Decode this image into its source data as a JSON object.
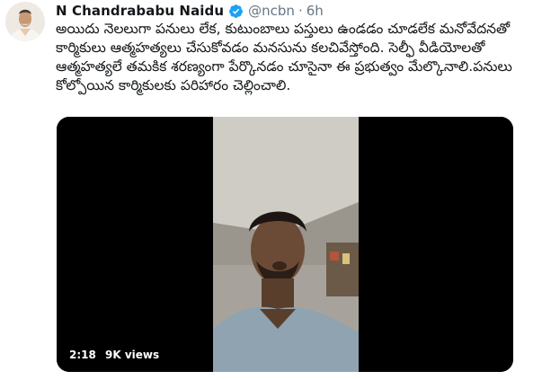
{
  "tweet": {
    "author_name": "N Chandrababu Naidu",
    "handle": "@ncbn",
    "separator": "·",
    "time_ago": "6h",
    "text": "అయిదు నెలలుగా పనులు లేక, కుటుంబాలు పస్తులు ఉండడం చూడలేక మనోవేదనతో కార్మికులు ఆత్మహత్యలు చేసుకోవడం మనసును కలచివేస్తోంది. సెల్ఫీ వీడియోలతో ఆత్మహత్యలే తమకిక శరణ్యంగా పేర్కొనడం చూసైనా ఈ ప్రభుత్వం మేల్కొనాలి.పనులు కోల్పోయిన కార్మికులకు పరిహారం చెల్లించాలి.",
    "verified_icon": "verified-badge-icon",
    "accent_color": "#1da1f2"
  },
  "video": {
    "duration": "2:18",
    "views": "9K views"
  }
}
